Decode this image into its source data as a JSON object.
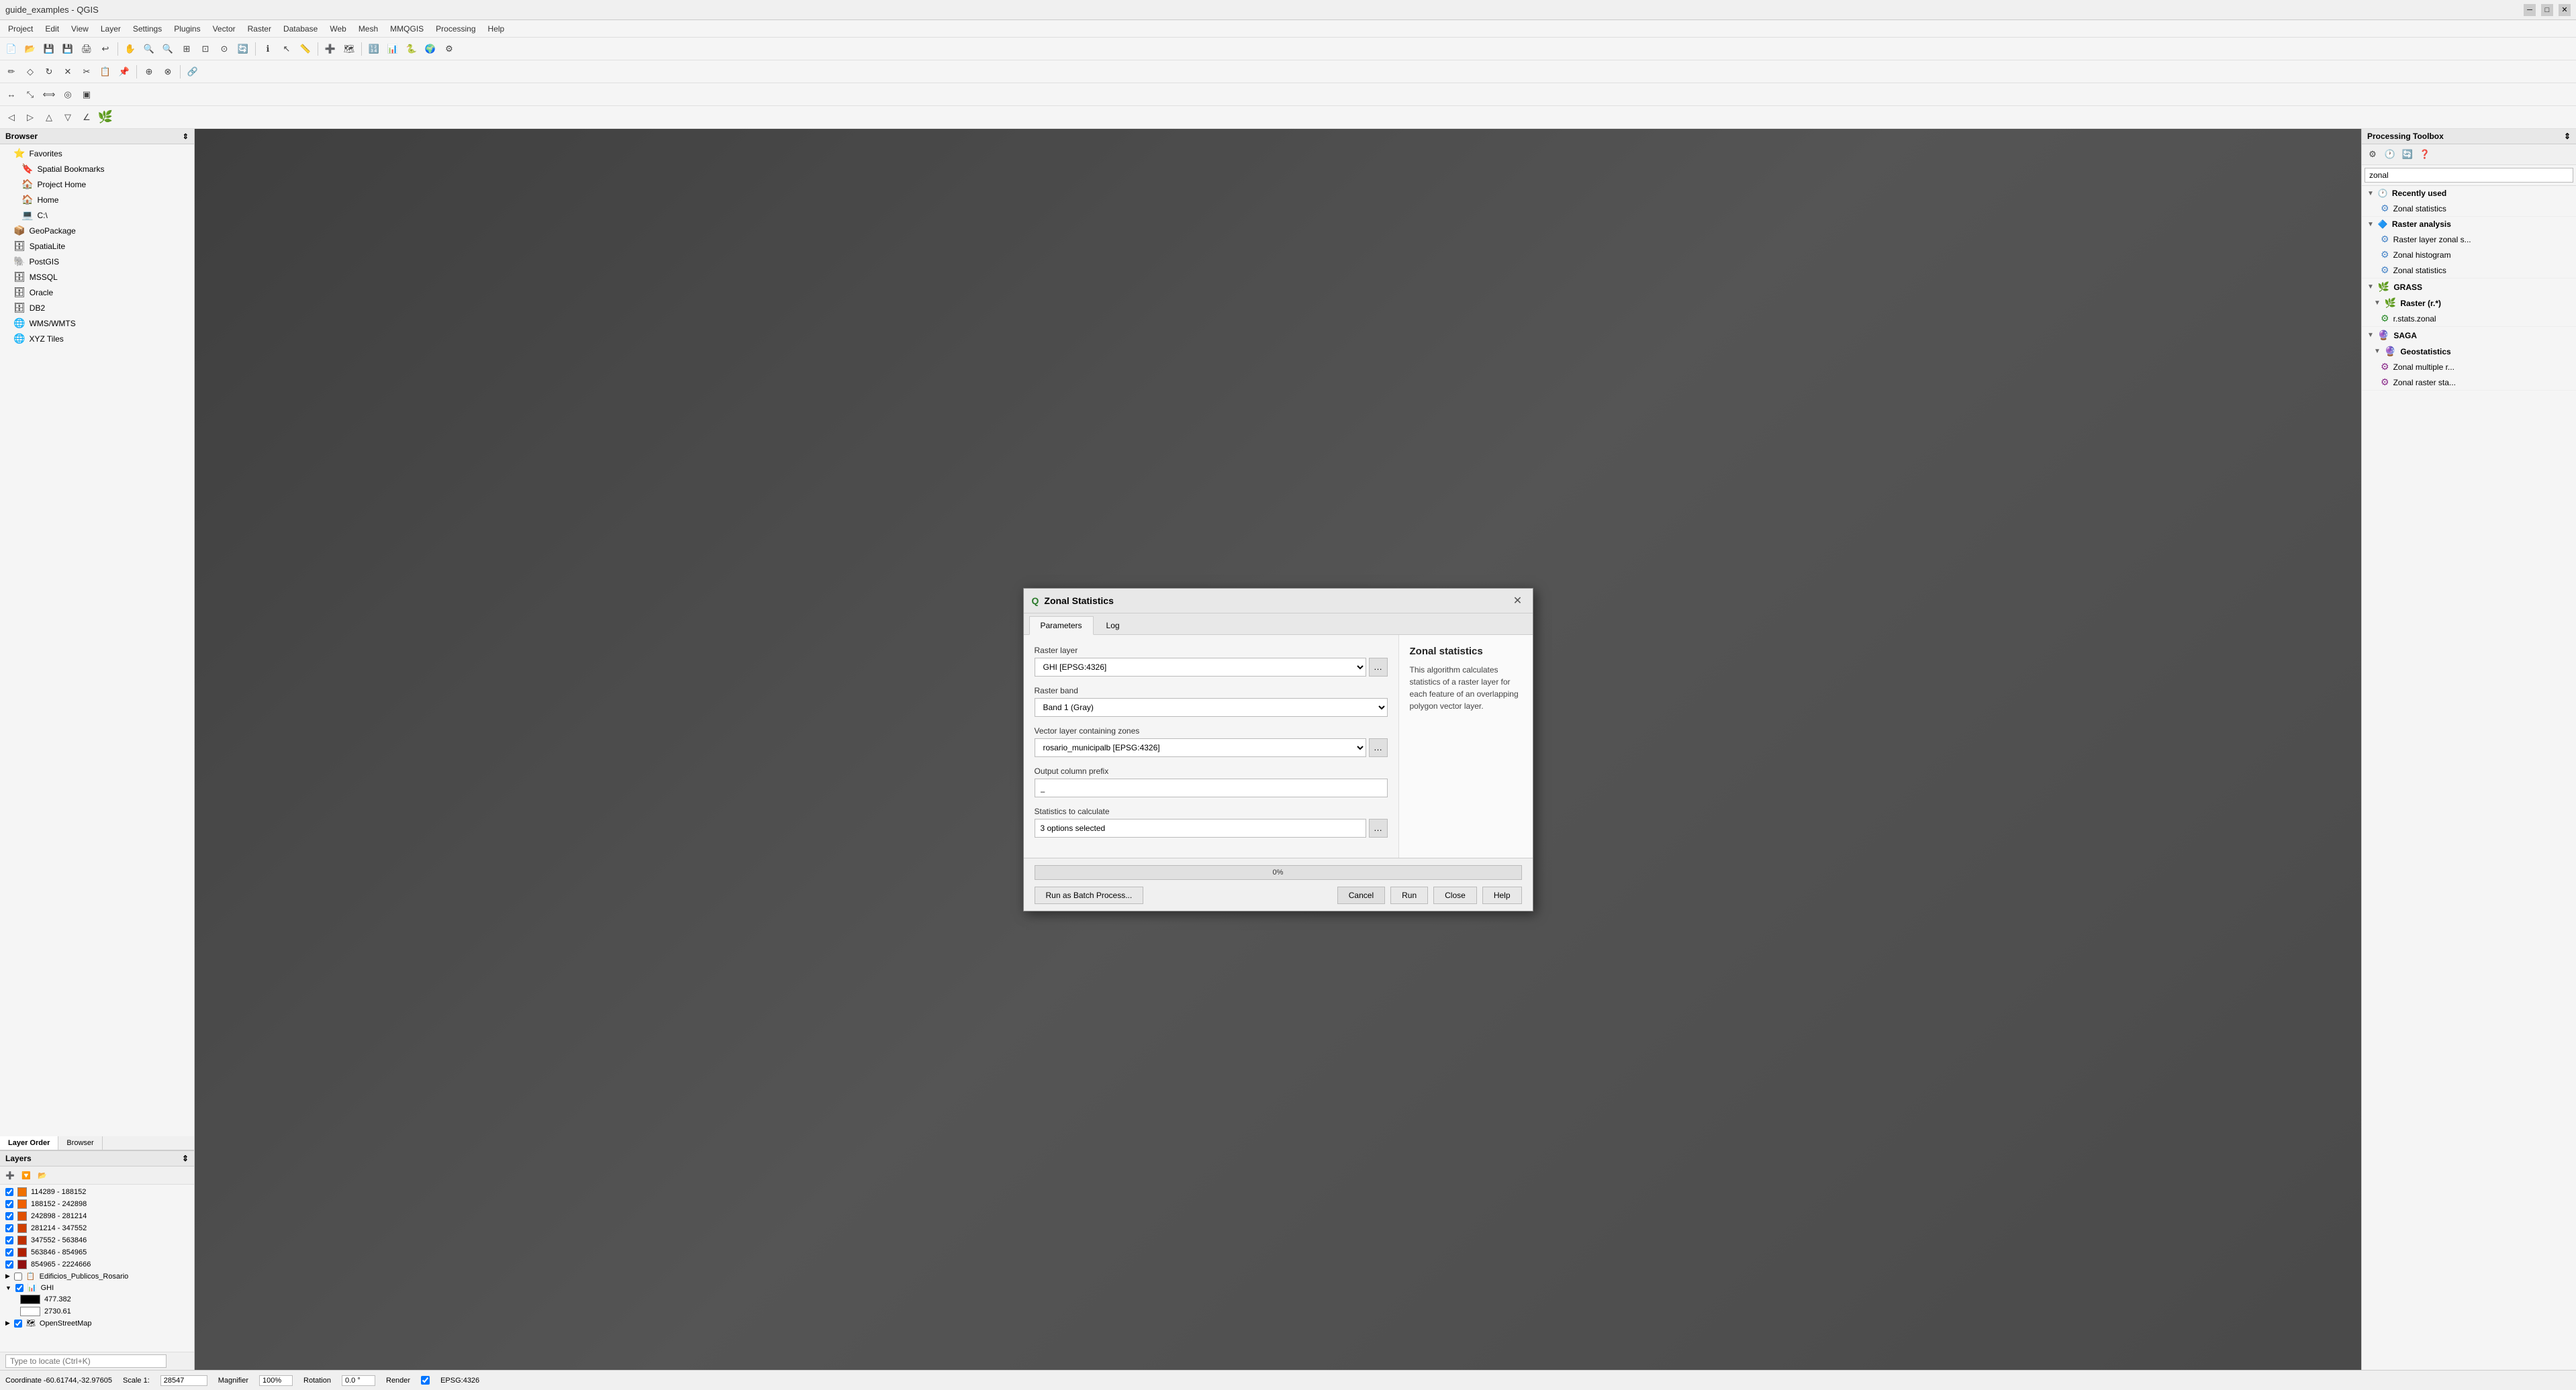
{
  "app": {
    "title": "guide_examples - QGIS",
    "icon": "Q"
  },
  "menu": {
    "items": [
      "Project",
      "Edit",
      "View",
      "Layer",
      "Settings",
      "Plugins",
      "Vector",
      "Raster",
      "Database",
      "Web",
      "Mesh",
      "MMQGIS",
      "Processing",
      "Help"
    ]
  },
  "browser": {
    "title": "Browser",
    "items": [
      {
        "label": "Favorites",
        "icon": "⭐",
        "indent": 0
      },
      {
        "label": "Spatial Bookmarks",
        "icon": "🔖",
        "indent": 1
      },
      {
        "label": "Project Home",
        "icon": "🏠",
        "indent": 1
      },
      {
        "label": "Home",
        "icon": "🏠",
        "indent": 1
      },
      {
        "label": "C:\\",
        "icon": "💻",
        "indent": 1
      },
      {
        "label": "GeoPackage",
        "icon": "📦",
        "indent": 0
      },
      {
        "label": "SpatiaLite",
        "icon": "🗄",
        "indent": 0
      },
      {
        "label": "PostGIS",
        "icon": "🐘",
        "indent": 0
      },
      {
        "label": "MSSQL",
        "icon": "🗄",
        "indent": 0
      },
      {
        "label": "Oracle",
        "icon": "🗄",
        "indent": 0
      },
      {
        "label": "DB2",
        "icon": "🗄",
        "indent": 0
      },
      {
        "label": "WMS/WMTS",
        "icon": "🌐",
        "indent": 0
      },
      {
        "label": "XYZ Tiles",
        "icon": "🌐",
        "indent": 0
      }
    ]
  },
  "panel_tabs": {
    "tabs": [
      "Layer Order",
      "Browser"
    ],
    "active": "Layer Order"
  },
  "layers": {
    "title": "Layers",
    "items": [
      {
        "label": "114289 - 188152",
        "color": "#f07000",
        "checked": true
      },
      {
        "label": "188152 - 242898",
        "color": "#f06000",
        "checked": true
      },
      {
        "label": "242898 - 281214",
        "color": "#e05000",
        "checked": true
      },
      {
        "label": "281214 - 347552",
        "color": "#d04000",
        "checked": true
      },
      {
        "label": "347552 - 563846",
        "color": "#c03000",
        "checked": true
      },
      {
        "label": "563846 - 854965",
        "color": "#b02000",
        "checked": true
      },
      {
        "label": "854965 - 2224666",
        "color": "#901010",
        "checked": true
      },
      {
        "label": "Edificios_Publicos_Rosario",
        "icon": "📋",
        "checked": false
      },
      {
        "label": "GHI",
        "icon": "📊",
        "checked": true,
        "expanded": true,
        "sublayers": [
          {
            "label": "477.382",
            "color": "#000000"
          },
          {
            "label": "2730.61",
            "color": "#ffffff"
          }
        ]
      },
      {
        "label": "OpenStreetMap",
        "icon": "🗺",
        "checked": true
      }
    ]
  },
  "processing_toolbox": {
    "title": "Processing Toolbox",
    "search_placeholder": "zonal",
    "search_value": "zonal",
    "sections": [
      {
        "label": "Recently used",
        "icon": "🕐",
        "expanded": true,
        "items": [
          {
            "label": "Zonal statistics",
            "icon": "⚙"
          }
        ]
      },
      {
        "label": "Raster analysis",
        "icon": "🔷",
        "expanded": true,
        "items": [
          {
            "label": "Raster layer zonal s...",
            "icon": "⚙"
          },
          {
            "label": "Zonal histogram",
            "icon": "⚙"
          },
          {
            "label": "Zonal statistics",
            "icon": "⚙"
          }
        ]
      },
      {
        "label": "GRASS",
        "icon": "🌿",
        "expanded": true,
        "subsections": [
          {
            "label": "Raster (r.*)",
            "expanded": true,
            "items": [
              {
                "label": "r.stats.zonal",
                "icon": "⚙"
              }
            ]
          }
        ]
      },
      {
        "label": "SAGA",
        "icon": "🔮",
        "expanded": true,
        "subsections": [
          {
            "label": "Geostatistics",
            "expanded": true,
            "items": [
              {
                "label": "Zonal multiple r...",
                "icon": "⚙"
              },
              {
                "label": "Zonal raster sta...",
                "icon": "⚙"
              }
            ]
          }
        ]
      }
    ]
  },
  "dialog": {
    "title": "Zonal Statistics",
    "icon": "Q",
    "tabs": [
      "Parameters",
      "Log"
    ],
    "active_tab": "Parameters",
    "fields": {
      "raster_layer": {
        "label": "Raster layer",
        "value": "GHI [EPSG:4326]"
      },
      "raster_band": {
        "label": "Raster band",
        "value": "Band 1 (Gray)"
      },
      "vector_layer": {
        "label": "Vector layer containing zones",
        "value": "rosario_municipalb [EPSG:4326]"
      },
      "output_column_prefix": {
        "label": "Output column prefix",
        "value": "_"
      },
      "statistics": {
        "label": "Statistics to calculate",
        "value": "3 options selected"
      }
    },
    "help": {
      "title": "Zonal statistics",
      "text": "This algorithm calculates statistics of a raster layer for each feature of an overlapping polygon vector layer."
    },
    "progress": {
      "value": 0,
      "label": "0%"
    },
    "buttons": {
      "batch": "Run as Batch Process...",
      "cancel": "Cancel",
      "run": "Run",
      "close": "Close",
      "help": "Help"
    }
  },
  "status_bar": {
    "coordinate": "Coordinate  -60.61744,-32.97605",
    "scale_label": "Scale 1:",
    "scale_value": "28547",
    "magnifier_label": "Magnifier",
    "magnifier_value": "100%",
    "rotation_label": "Rotation",
    "rotation_value": "0.0 °",
    "render_label": "Render",
    "epsg": "EPSG:4326"
  },
  "locate_bar": {
    "placeholder": "Type to locate (Ctrl+K)"
  }
}
